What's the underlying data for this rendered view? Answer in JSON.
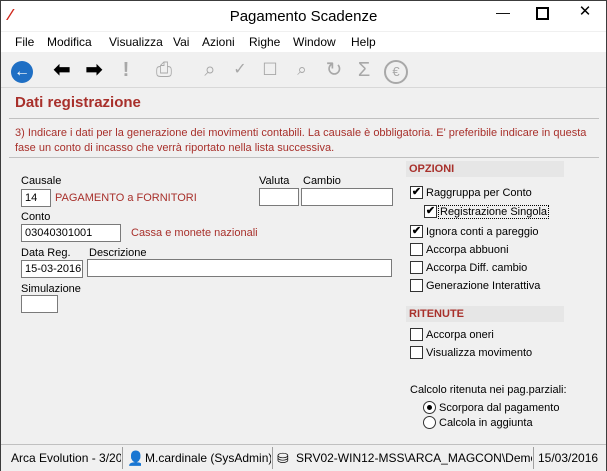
{
  "window": {
    "title": "Pagamento Scadenze"
  },
  "menu": [
    "File",
    "Modifica",
    "Visualizza",
    "Vai",
    "Azioni",
    "Righe",
    "Window",
    "Help"
  ],
  "section_title": "Dati registrazione",
  "info_text": "3) Indicare i dati per la generazione dei movimenti contabili. La causale è obbligatoria. E' preferibile indicare in questa fase un conto di incasso che verrà riportato nella lista successiva.",
  "form": {
    "causale_label": "Causale",
    "causale_value": "14",
    "causale_desc": "PAGAMENTO a FORNITORI",
    "valuta_label": "Valuta",
    "valuta_value": "",
    "cambio_label": "Cambio",
    "cambio_value": "",
    "conto_label": "Conto",
    "conto_value": "03040301001",
    "conto_desc": "Cassa e monete nazionali",
    "data_label": "Data Reg.",
    "data_value": "15-03-2016",
    "descrizione_label": "Descrizione",
    "descrizione_value": "",
    "simulazione_label": "Simulazione",
    "simulazione_value": ""
  },
  "opzioni": {
    "header": "OPZIONI",
    "items": [
      {
        "label": "Raggruppa per Conto",
        "checked": true
      },
      {
        "label": "Registrazione Singola",
        "checked": true
      },
      {
        "label": "Ignora conti a pareggio",
        "checked": true
      },
      {
        "label": "Accorpa abbuoni",
        "checked": false
      },
      {
        "label": "Accorpa Diff. cambio",
        "checked": false
      },
      {
        "label": "Generazione Interattiva",
        "checked": false
      }
    ]
  },
  "ritenute": {
    "header": "RITENUTE",
    "items": [
      {
        "label": "Accorpa oneri",
        "checked": false
      },
      {
        "label": "Visualizza movimento",
        "checked": false
      }
    ],
    "calcolo_label": "Calcolo ritenuta nei pag.parziali:",
    "radios": [
      {
        "label": "Scorpora dal pagamento",
        "selected": true
      },
      {
        "label": "Calcola in aggiunta",
        "selected": false
      }
    ]
  },
  "status": {
    "app": "Arca Evolution - 3/20",
    "user": "M.cardinale (SysAdmin)",
    "server": "SRV02-WIN12-MSS\\ARCA_MAGCON\\Demo",
    "date": "15/03/2016"
  },
  "icons": {
    "app": "arca-logo-icon",
    "home": "home-circle-icon",
    "back": "back-arrow-icon",
    "forward": "forward-arrow-icon",
    "alert": "exclamation-icon",
    "print": "printer-icon",
    "preview": "print-preview-icon",
    "check": "check-icon",
    "checkbox": "checkbox-icon",
    "search": "search-icon",
    "refresh": "refresh-icon",
    "sum": "sigma-icon",
    "euro": "euro-icon",
    "user": "user-icon",
    "database": "database-icon"
  }
}
